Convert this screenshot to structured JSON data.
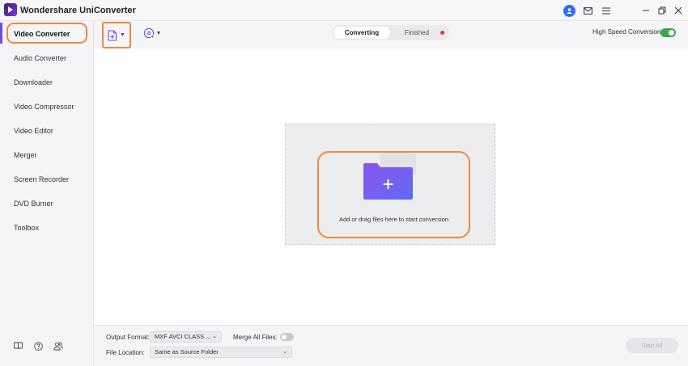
{
  "app": {
    "title": "Wondershare UniConverter"
  },
  "sidebar": {
    "items": [
      {
        "label": "Video Converter"
      },
      {
        "label": "Audio Converter"
      },
      {
        "label": "Downloader"
      },
      {
        "label": "Video Compressor"
      },
      {
        "label": "Video Editor"
      },
      {
        "label": "Merger"
      },
      {
        "label": "Screen Recorder"
      },
      {
        "label": "DVD Burner"
      },
      {
        "label": "Toolbox"
      }
    ],
    "active_index": 0,
    "bottom_icons": [
      "book-icon",
      "help-icon",
      "community-icon"
    ]
  },
  "toolbar": {
    "tabs": [
      {
        "label": "Converting"
      },
      {
        "label": "Finished"
      }
    ],
    "active_tab": 0,
    "high_speed_label": "High Speed Conversion",
    "high_speed_on": true
  },
  "drop": {
    "text": "Add or drag files here to start conversion"
  },
  "bottom": {
    "output_format_label": "Output Format:",
    "output_format_value": "MXF AVCI CLASS ...",
    "merge_label": "Merge All Files:",
    "merge_on": false,
    "file_location_label": "File Location:",
    "file_location_value": "Same as Source Folder",
    "start_all_label": "Start All"
  },
  "colors": {
    "accent": "#6d4fe0",
    "highlight": "#ee8a3a",
    "toggle_on": "#37a84f",
    "notify_dot": "#e33b3b",
    "avatar": "#2e6cf6"
  }
}
